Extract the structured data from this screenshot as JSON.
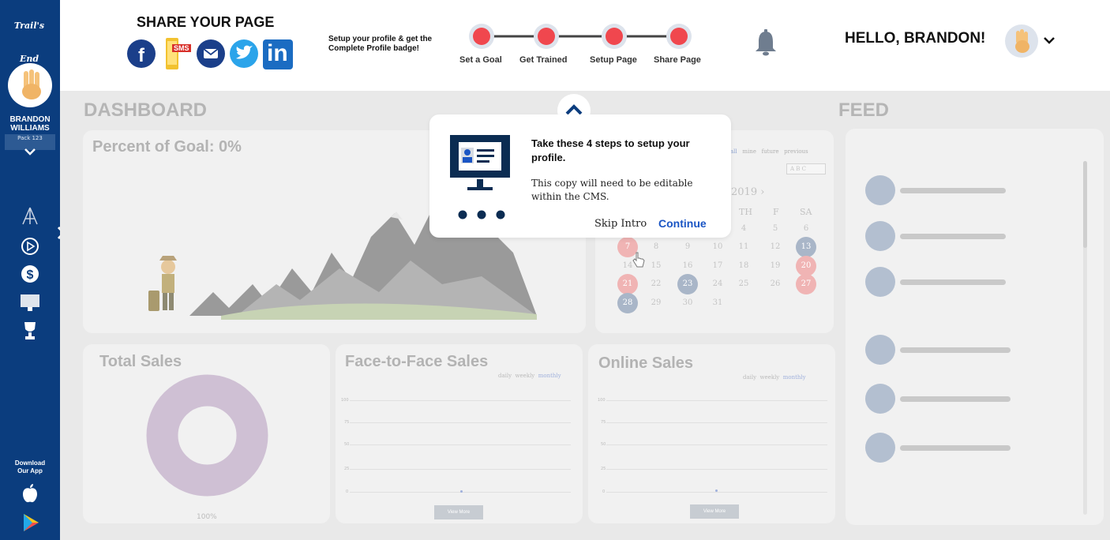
{
  "sidebar": {
    "logo_text": "Trail's End",
    "user_name_line1": "BRANDON",
    "user_name_line2": "WILLIAMS",
    "pack": "Pack 123",
    "nav_icons": [
      "tent-icon",
      "play-icon",
      "dollar-icon",
      "monitor-icon",
      "trophy-icon"
    ],
    "download_line1": "Download",
    "download_line2": "Our App"
  },
  "header": {
    "share_title": "SHARE YOUR PAGE",
    "social": [
      "facebook-icon",
      "sms-icon",
      "email-icon",
      "twitter-icon",
      "linkedin-icon"
    ],
    "sms_label": "SMS",
    "linkedin_label": "in",
    "profile_prompt": "Setup your profile & get the Complete Profile badge!",
    "steps": [
      "Set a Goal",
      "Get Trained",
      "Setup Page",
      "Share Page"
    ],
    "greeting": "HELLO, BRANDON!"
  },
  "dashboard": {
    "title": "DASHBOARD",
    "goal_title": "Percent of Goal: 0%",
    "calendar": {
      "filters": [
        "all",
        "mine",
        "future",
        "previous"
      ],
      "search_placeholder": "A B C",
      "month_label": "2019",
      "weekdays": [
        "TH",
        "F",
        "SA"
      ],
      "rows": [
        [
          "",
          "",
          "",
          "",
          "4",
          "5",
          "6"
        ],
        [
          "7",
          "8",
          "9",
          "10",
          "11",
          "12",
          "13"
        ],
        [
          "14",
          "15",
          "16",
          "17",
          "18",
          "19",
          "20"
        ],
        [
          "21",
          "22",
          "23",
          "24",
          "25",
          "26",
          "27"
        ],
        [
          "28",
          "29",
          "30",
          "31",
          "",
          "",
          ""
        ]
      ],
      "red_days": [
        "7",
        "20",
        "21",
        "27"
      ],
      "blue_days": [
        "13",
        "23",
        "28"
      ]
    },
    "total_sales": {
      "title": "Total Sales",
      "donut_label": "100%"
    },
    "f2f_sales": {
      "title": "Face-to-Face Sales",
      "tabs": [
        "daily",
        "weekly",
        "monthly"
      ],
      "y_ticks": [
        "100",
        "75",
        "50",
        "25",
        "0"
      ],
      "view_more": "View More"
    },
    "online_sales": {
      "title": "Online Sales",
      "tabs": [
        "daily",
        "weekly",
        "monthly"
      ],
      "y_ticks": [
        "100",
        "75",
        "50",
        "25",
        "0"
      ],
      "view_more": "View More"
    }
  },
  "feed": {
    "title": "FEED"
  },
  "popup": {
    "title": "Take these 4 steps to setup your profile.",
    "body": "This copy will need to be editable within the CMS.",
    "skip": "Skip Intro",
    "continue": "Continue"
  },
  "colors": {
    "sidebar": "#0b3d7e",
    "step_red": "#f0474e",
    "accent_blue": "#1a55c4"
  }
}
